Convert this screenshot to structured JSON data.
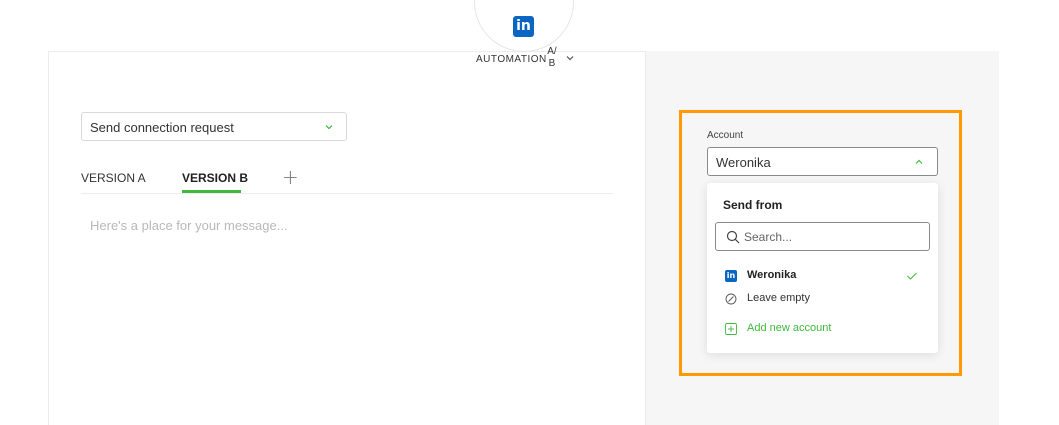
{
  "header": {
    "network_icon": "linkedin-icon",
    "automation_label": "AUTOMATION",
    "ab_label": "A/ B"
  },
  "editor": {
    "action_select_value": "Send connection request",
    "tabs": [
      {
        "label": "VERSION A",
        "active": false
      },
      {
        "label": "VERSION B",
        "active": true
      }
    ],
    "add_tab_symbol": "+",
    "message_placeholder": "Here's a place for your message..."
  },
  "account_panel": {
    "label": "Account",
    "selected_value": "Weronika",
    "highlight_color": "#ff9a00",
    "dropdown": {
      "title": "Send from",
      "search_placeholder": "Search...",
      "items": [
        {
          "label": "Weronika",
          "icon": "linkedin-icon",
          "selected": true
        },
        {
          "label": "Leave empty",
          "icon": "empty-circle-icon",
          "selected": false
        },
        {
          "label": "Add new account",
          "icon": "add-square-icon",
          "selected": false
        }
      ]
    }
  },
  "colors": {
    "accent_green": "#3fba3f",
    "linkedin_blue": "#0a66c2"
  }
}
